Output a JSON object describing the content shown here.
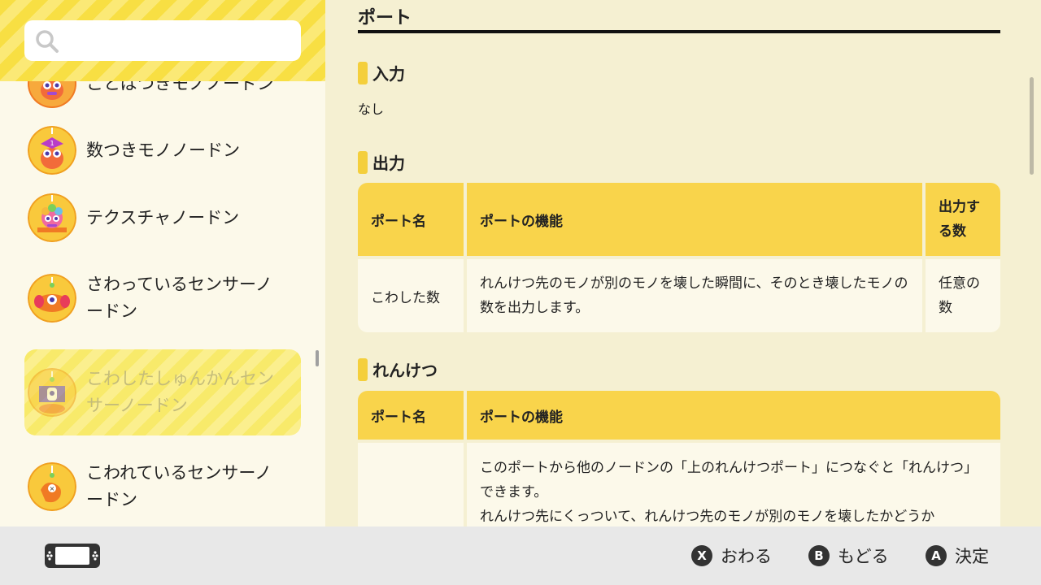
{
  "sidebar": {
    "search": {
      "value": ""
    },
    "items": [
      {
        "label": "ことばつきモノノードン"
      },
      {
        "label": "数つきモノノードン"
      },
      {
        "label": "テクスチャノードン"
      },
      {
        "label": "さわっているセンサーノードン"
      },
      {
        "label": "こわしたしゅんかんセンサーノードン",
        "selected": true
      },
      {
        "label": "こわれているセンサーノードン"
      }
    ]
  },
  "main": {
    "title": "ポート",
    "input": {
      "heading": "入力",
      "text": "なし"
    },
    "output": {
      "heading": "出力",
      "headers": [
        "ポート名",
        "ポートの機能",
        "出力する数"
      ],
      "rows": [
        {
          "name": "こわした数",
          "desc": "れんけつ先のモノが別のモノを壊した瞬間に、そのとき壊したモノの数を出力します。",
          "count": "任意の数"
        }
      ]
    },
    "link": {
      "heading": "れんけつ",
      "headers": [
        "ポート名",
        "ポートの機能"
      ],
      "rows": [
        {
          "name": "",
          "desc_line1": "このポートから他のノードンの「上のれんけつポート」につなぐと「れんけつ」できます。",
          "desc_line2": "れんけつ先にくっついて、れんけつ先のモノが別のモノを壊したかどうか"
        }
      ]
    }
  },
  "footer": {
    "buttons": [
      {
        "key": "X",
        "label": "おわる"
      },
      {
        "key": "B",
        "label": "もどる"
      },
      {
        "key": "A",
        "label": "決定"
      }
    ]
  },
  "colors": {
    "accent_yellow": "#f9d44b",
    "header_stripe": "#f8df43",
    "panel_bg": "#fcf9ea",
    "main_bg": "#f5f0d2",
    "footer_bg": "#e8e8e8"
  }
}
